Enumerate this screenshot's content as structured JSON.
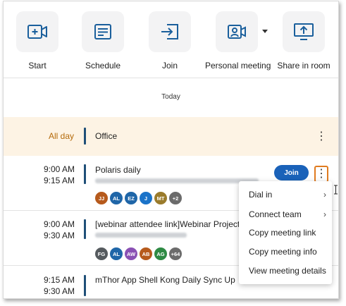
{
  "toolbar": {
    "start": "Start",
    "schedule": "Schedule",
    "join": "Join",
    "personal_meeting": "Personal meeting",
    "share_in_room": "Share in room"
  },
  "day_label": "Today",
  "all_day": {
    "label": "All day",
    "title": "Office"
  },
  "meetings": [
    {
      "start": "9:00 AM",
      "end": "9:15 AM",
      "title": "Polaris daily",
      "join_label": "Join",
      "avatars": [
        {
          "initials": "JJ",
          "color": "#b65a1c"
        },
        {
          "initials": "AL",
          "color": "#1f66a8"
        },
        {
          "initials": "EZ",
          "color": "#1f66a8"
        },
        {
          "initials": "J",
          "color": "#1a73c9"
        },
        {
          "initials": "MT",
          "color": "#9a7b2c"
        },
        {
          "initials": "+2",
          "color": "#6b6b6b"
        }
      ]
    },
    {
      "start": "9:00 AM",
      "end": "9:30 AM",
      "title": "[webinar attendee link]Webinar Project",
      "avatars": [
        {
          "initials": "FG",
          "color": "#555a5e"
        },
        {
          "initials": "AL",
          "color": "#1f66a8"
        },
        {
          "initials": "AW",
          "color": "#8a50b4"
        },
        {
          "initials": "AB",
          "color": "#b65a1c"
        },
        {
          "initials": "AG",
          "color": "#2e8a44"
        },
        {
          "initials": "+64",
          "color": "#6b6b6b"
        }
      ]
    },
    {
      "start": "9:15 AM",
      "end": "9:30 AM",
      "title": "mThor App Shell Kong Daily Sync Up"
    }
  ],
  "context_menu": {
    "items": [
      {
        "label": "Dial in",
        "submenu": true
      },
      {
        "label": "Connect team",
        "submenu": true
      },
      {
        "label": "Copy meeting link",
        "submenu": false
      },
      {
        "label": "Copy meeting info",
        "submenu": false
      },
      {
        "label": "View meeting details",
        "submenu": false
      }
    ]
  },
  "colors": {
    "accent_blue": "#1a62b9",
    "icon_blue": "#1a5f9c",
    "allday_bg": "#fdf3e4",
    "allday_text": "#b46a0a",
    "highlight_orange": "#e07b1f"
  },
  "icons": [
    "video-plus-icon",
    "calendar-list-icon",
    "sign-in-icon",
    "person-card-icon",
    "screen-share-icon",
    "kebab-icon",
    "chevron-right-icon"
  ]
}
